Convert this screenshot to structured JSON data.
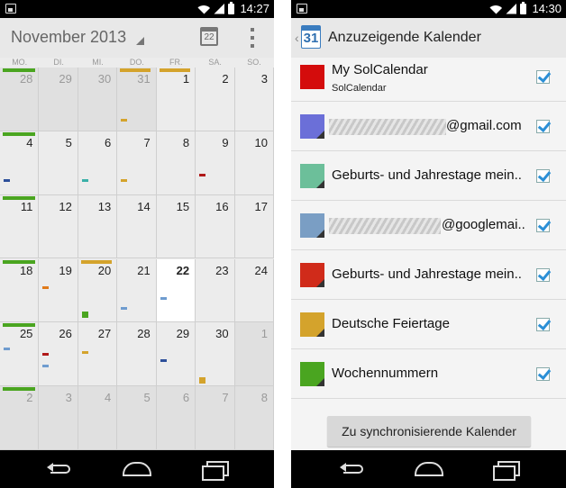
{
  "left_screen": {
    "status_time": "14:27",
    "month_title": "November 2013",
    "today_icon_day": "22",
    "weekdays": [
      "MO.",
      "DI.",
      "MI.",
      "DO.",
      "FR.",
      "SA.",
      "SO."
    ],
    "weeks": [
      [
        "28",
        "29",
        "30",
        "31",
        "1",
        "2",
        "3"
      ],
      [
        "4",
        "5",
        "6",
        "7",
        "8",
        "9",
        "10"
      ],
      [
        "11",
        "12",
        "13",
        "14",
        "15",
        "16",
        "17"
      ],
      [
        "18",
        "19",
        "20",
        "21",
        "22",
        "23",
        "24"
      ],
      [
        "25",
        "26",
        "27",
        "28",
        "29",
        "30",
        "1"
      ],
      [
        "2",
        "3",
        "4",
        "5",
        "6",
        "7",
        "8"
      ]
    ]
  },
  "right_screen": {
    "status_time": "14:30",
    "app_icon_day": "31",
    "title": "Anzuzeigende Kalender",
    "calendars": [
      {
        "name": "My SolCalendar",
        "subtitle": "SolCalendar",
        "color": "#d40c0c",
        "checked": true
      },
      {
        "name": "@gmail.com",
        "color": "#6b6fd8",
        "checked": true
      },
      {
        "name": "Geburts- und Jahrestage mein..",
        "color": "#6cbf9a",
        "checked": true
      },
      {
        "name": "@googlemai..",
        "color": "#7a9ec4",
        "checked": true
      },
      {
        "name": "Geburts- und Jahrestage mein..",
        "color": "#d02b1a",
        "checked": true
      },
      {
        "name": "Deutsche Feiertage",
        "color": "#d4a32c",
        "checked": true
      },
      {
        "name": "Wochennummern",
        "color": "#4aa520",
        "checked": true
      }
    ],
    "sync_button": "Zu synchronisierende Kalender"
  }
}
